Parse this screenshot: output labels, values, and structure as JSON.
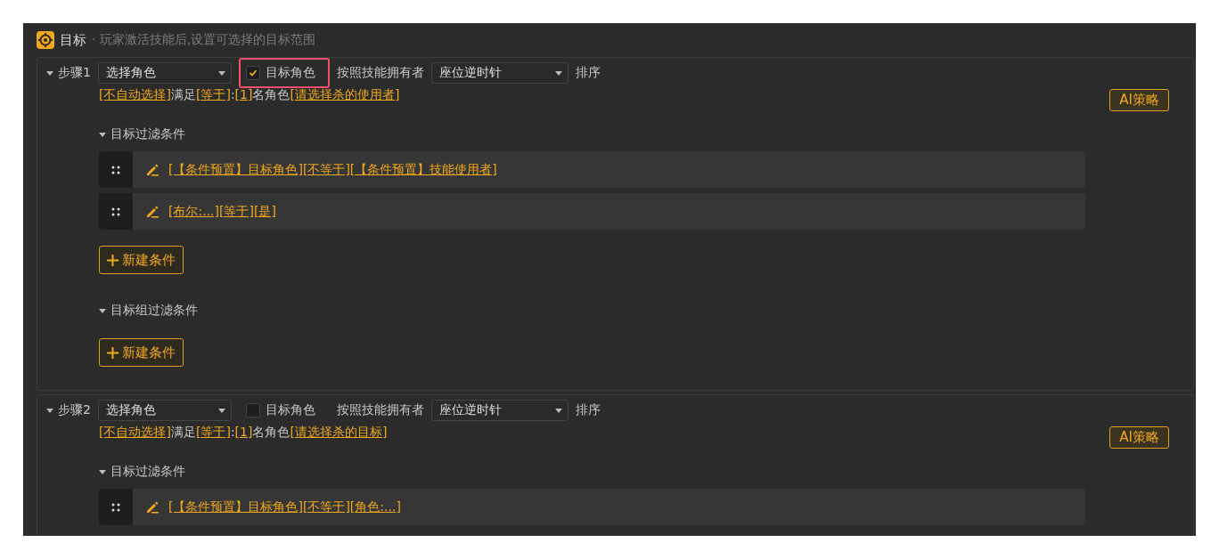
{
  "panel": {
    "title": "目标",
    "subtitle": "· 玩家激活技能后,设置可选择的目标范围"
  },
  "steps": [
    {
      "label": "步骤1",
      "expanded": true,
      "role_select": "选择角色",
      "target_checkbox": {
        "label": "目标角色",
        "checked": true,
        "highlighted": true
      },
      "order_by_label": "按照技能拥有者",
      "order_select": "座位逆时针",
      "sort_label": "排序",
      "ai_button": "AI策略",
      "rule": [
        {
          "text": "[不自动选择]",
          "kind": "link"
        },
        {
          "text": "满足",
          "kind": "plain"
        },
        {
          "text": "[等于]",
          "kind": "link"
        },
        {
          "text": ":",
          "kind": "plain"
        },
        {
          "text": "[1]",
          "kind": "link"
        },
        {
          "text": "名角色",
          "kind": "plain"
        },
        {
          "text": "[请选择杀的使用者]",
          "kind": "link"
        }
      ],
      "sections": [
        {
          "title": "目标过滤条件",
          "expanded": true,
          "conditions": [
            "[【条件预置】目标角色][不等于][【条件预置】技能使用者]",
            "[布尔:...][等于][是]"
          ],
          "new_button": "新建条件"
        },
        {
          "title": "目标组过滤条件",
          "expanded": true,
          "new_button": "新建条件"
        }
      ]
    },
    {
      "label": "步骤2",
      "expanded": true,
      "role_select": "选择角色",
      "target_checkbox": {
        "label": "目标角色",
        "checked": false,
        "highlighted": false
      },
      "order_by_label": "按照技能拥有者",
      "order_select": "座位逆时针",
      "sort_label": "排序",
      "ai_button": "AI策略",
      "rule": [
        {
          "text": "[不自动选择]",
          "kind": "link"
        },
        {
          "text": "满足",
          "kind": "plain"
        },
        {
          "text": "[等于]",
          "kind": "link"
        },
        {
          "text": ":",
          "kind": "plain"
        },
        {
          "text": "[1]",
          "kind": "link"
        },
        {
          "text": "名角色",
          "kind": "plain"
        },
        {
          "text": "[请选择杀的目标]",
          "kind": "link"
        }
      ],
      "sections": [
        {
          "title": "目标过滤条件",
          "expanded": true,
          "conditions": [
            "[【条件预置】目标角色][不等于][角色:...]"
          ]
        }
      ]
    }
  ]
}
